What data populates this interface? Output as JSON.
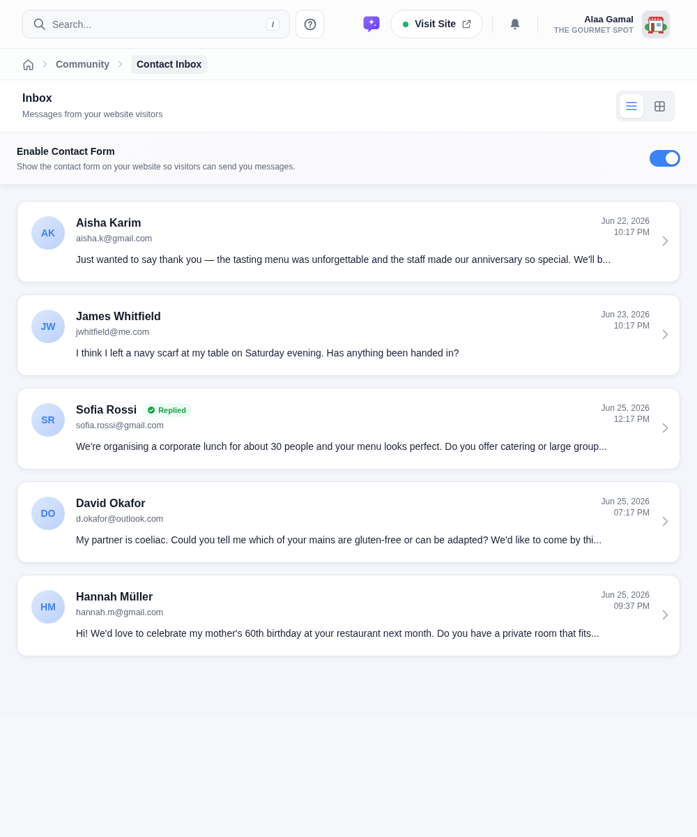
{
  "header": {
    "search": {
      "placeholder": "Search...",
      "shortcut": "/"
    },
    "visit_site": {
      "label": "Visit Site"
    },
    "user": {
      "name": "Alaa Gamal",
      "business": "THE GOURMET SPOT"
    }
  },
  "breadcrumb": [
    {
      "label": "Community",
      "selected": false
    },
    {
      "label": "Contact Inbox",
      "selected": true
    }
  ],
  "page": {
    "title": "Inbox",
    "subtitle": "Messages from your website visitors"
  },
  "view_toggle": [
    {
      "kind": "list",
      "selected": true
    },
    {
      "kind": "grid",
      "selected": false
    }
  ],
  "contact_form": {
    "title": "Enable Contact Form",
    "description": "Show the contact form on your website so visitors can send you messages.",
    "on": true
  },
  "messages": [
    {
      "initials": "AK",
      "name": "Aisha Karim",
      "email": "aisha.k@gmail.com",
      "date": "Jun 22, 2026",
      "time": "10:17 PM",
      "preview": "Just wanted to say thank you — the tasting menu was unforgettable and the staff made our anniversary so special. We'll b..."
    },
    {
      "initials": "JW",
      "name": "James Whitfield",
      "email": "jwhitfield@me.com",
      "date": "Jun 23, 2026",
      "time": "10:17 PM",
      "preview": "I think I left a navy scarf at my table on Saturday evening. Has anything been handed in?"
    },
    {
      "initials": "SR",
      "name": "Sofia Rossi",
      "badge": "Replied",
      "email": "sofia.rossi@gmail.com",
      "date": "Jun 25, 2026",
      "time": "12:17 PM",
      "preview": "We're organising a corporate lunch for about 30 people and your menu looks perfect. Do you offer catering or large group..."
    },
    {
      "initials": "DO",
      "name": "David Okafor",
      "email": "d.okafor@outlook.com",
      "date": "Jun 25, 2026",
      "time": "07:17 PM",
      "preview": "My partner is coeliac. Could you tell me which of your mains are gluten-free or can be adapted? We'd like to come by thi..."
    },
    {
      "initials": "HM",
      "name": "Hannah Müller",
      "email": "hannah.m@gmail.com",
      "date": "Jun 25, 2026",
      "time": "09:37 PM",
      "preview": "Hi! We'd love to celebrate my mother's 60th birthday at your restaurant next month. Do you have a private room that fits..."
    }
  ]
}
